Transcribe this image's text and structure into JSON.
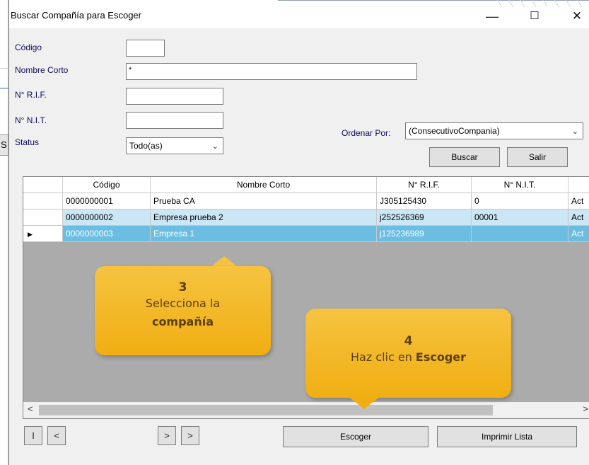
{
  "window": {
    "title": "Buscar Compañía para Escoger",
    "minimize_glyph": "—",
    "maximize_glyph": "☐",
    "close_glyph": "✕"
  },
  "background_app": {
    "fragment_text": "S"
  },
  "form": {
    "codigo_label": "Código",
    "codigo_value": "",
    "nombre_corto_label": "Nombre Corto",
    "nombre_corto_value": "*",
    "rif_label": "N° R.I.F.",
    "rif_value": "",
    "nit_label": "N° N.I.T.",
    "nit_value": "",
    "status_label": "Status",
    "status_value": "Todo(as)",
    "ordenar_label": "Ordenar Por:",
    "ordenar_value": "(ConsecutivoCompania)"
  },
  "buttons": {
    "buscar": "Buscar",
    "salir": "Salir",
    "escoger": "Escoger",
    "imprimir": "Imprimir Lista"
  },
  "grid": {
    "columns": [
      "Código",
      "Nombre Corto",
      "N° R.I.F.",
      "N° N.I.T.",
      ""
    ],
    "rows": [
      [
        "0000000001",
        "Prueba CA",
        "J305125430",
        "0",
        "Act"
      ],
      [
        "0000000002",
        "Empresa prueba 2",
        "j252526369",
        "00001",
        "Act"
      ],
      [
        "0000000003",
        "Empresa 1",
        "j125236989",
        "",
        "Act"
      ]
    ],
    "selected_row_index": 2,
    "scroll_left_glyph": "<",
    "scroll_right_glyph": ">"
  },
  "nav": {
    "first": "I",
    "prev": "<",
    "next": ">",
    "last": ">"
  },
  "callouts": {
    "step3_num": "3",
    "step3_line1": "Selecciona la",
    "step3_bold": "compañía",
    "step4_num": "4",
    "step4_text": "Haz clic en ",
    "step4_bold": "Escoger"
  },
  "colors": {
    "selected_row": "#6bbde2",
    "alt_row": "#cbe6f4",
    "callout": "#f0ae12",
    "label_text": "#0a0a5c"
  }
}
